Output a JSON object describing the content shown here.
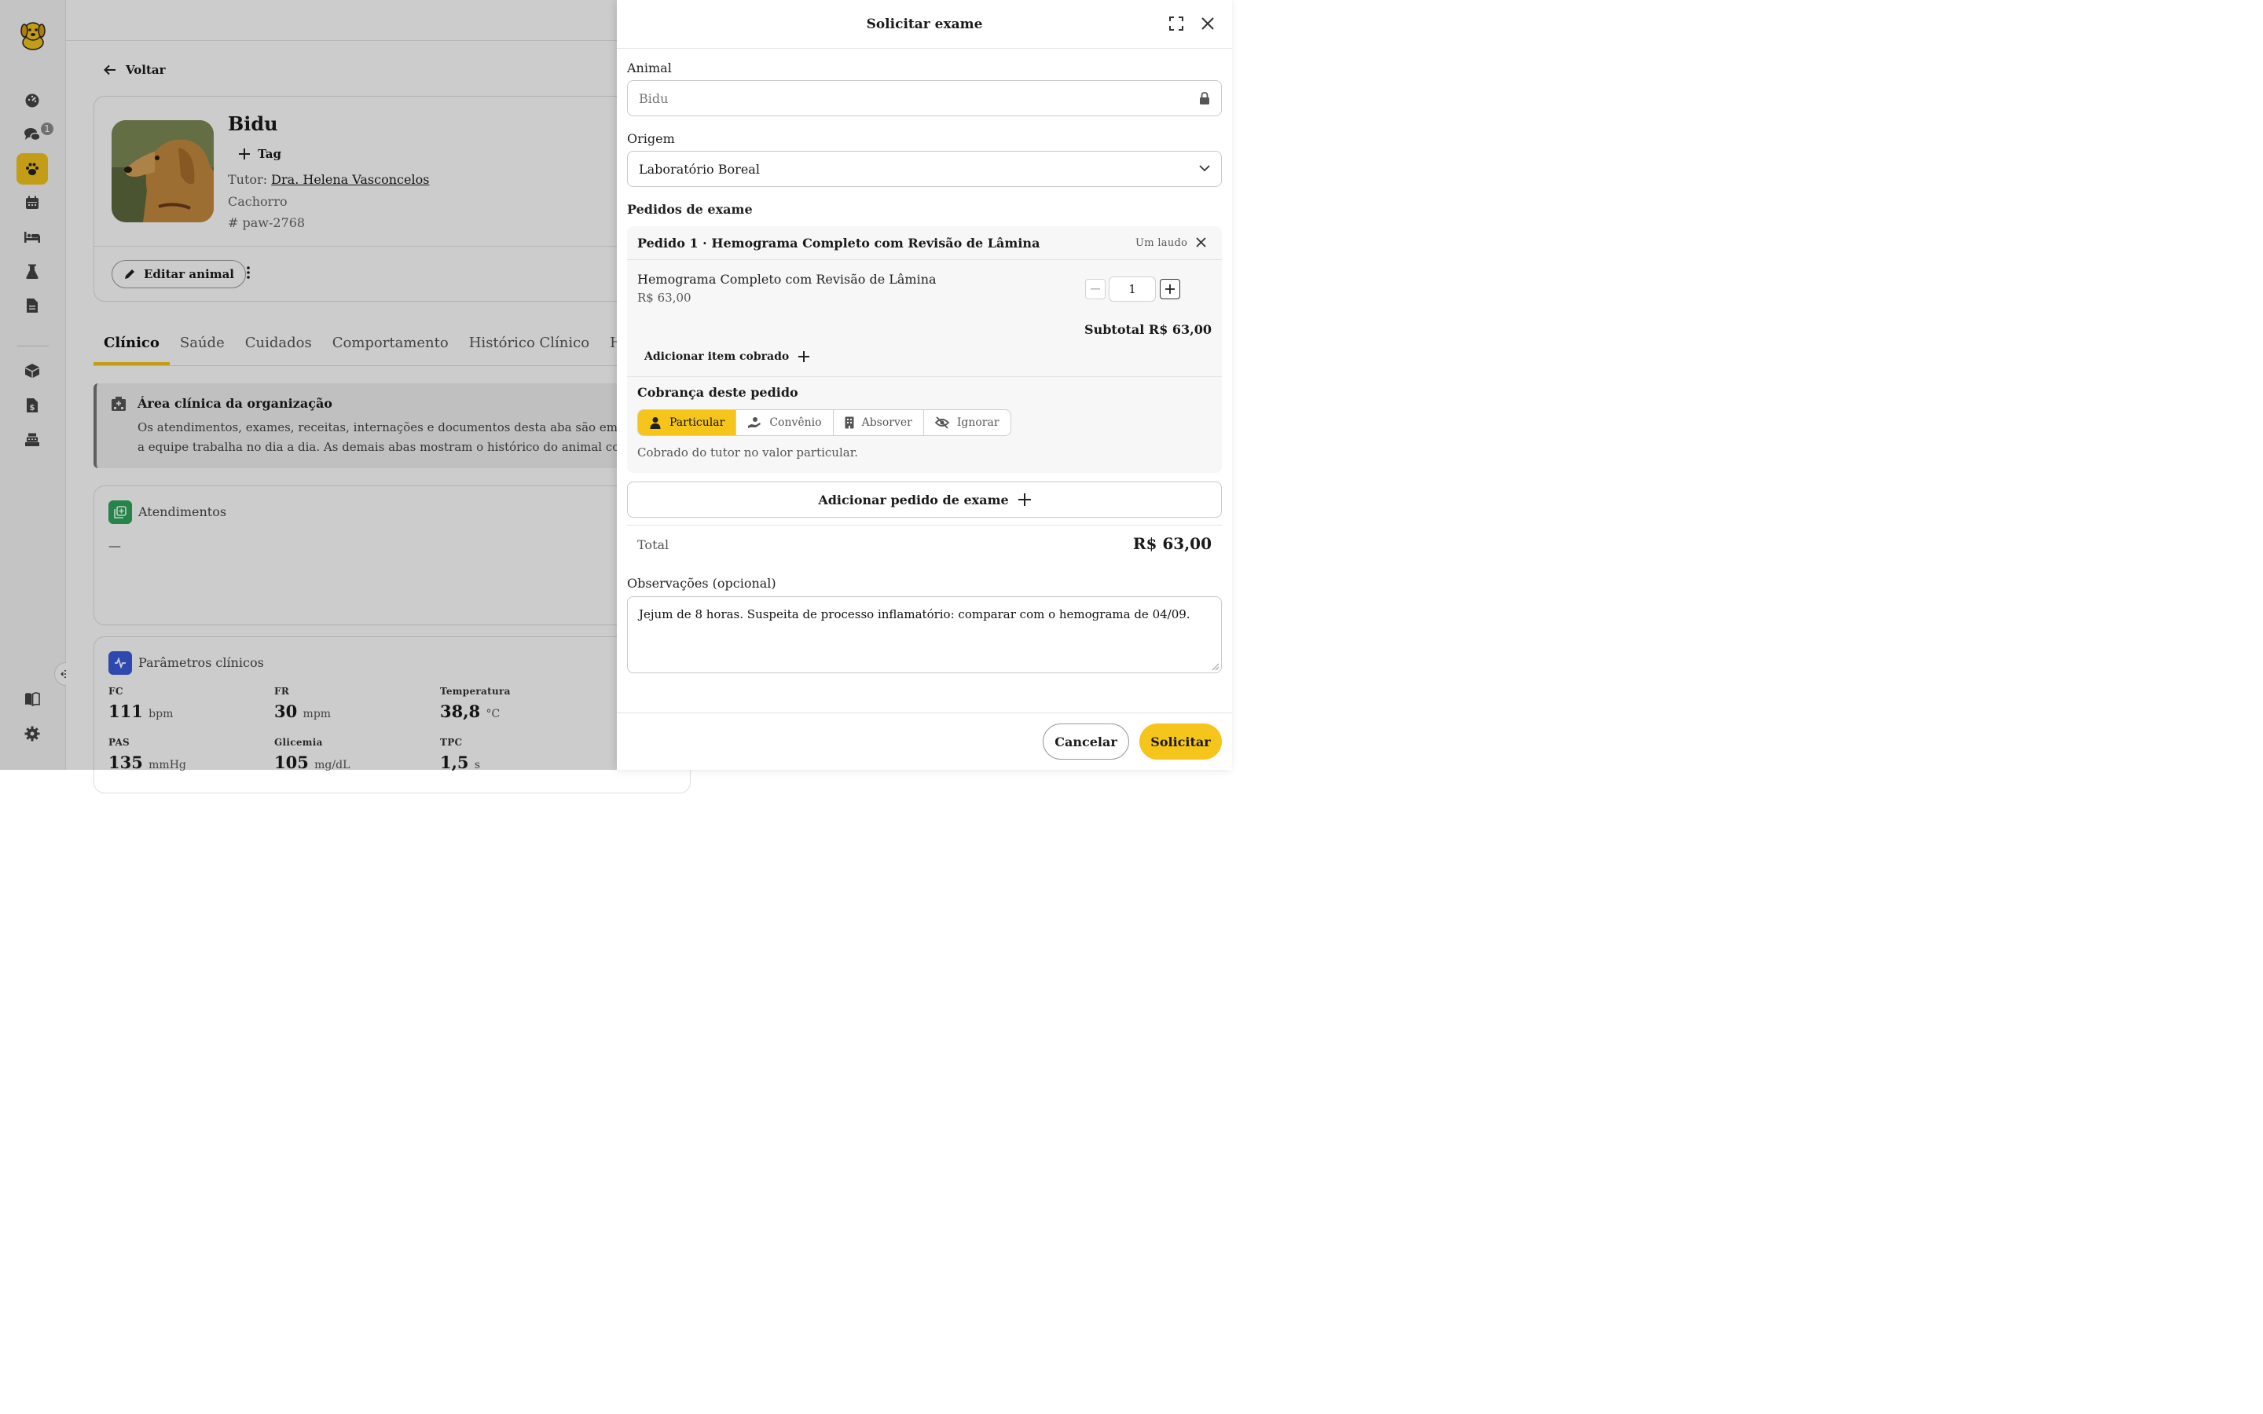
{
  "sidebar": {
    "icons": [
      "logo-icon",
      "dashboard-icon",
      "chat-icon",
      "paw-icon",
      "calendar-icon",
      "bed-icon",
      "flask-icon",
      "document-icon",
      "package-icon",
      "billing-icon",
      "cash-register-icon",
      "book-icon",
      "gear-icon"
    ],
    "chat_badge": "1",
    "active_item": "paw-icon",
    "accent": "#f5c51c"
  },
  "back_label": "Voltar",
  "animal": {
    "name": "Bidu",
    "tag_label": "Tag",
    "tutor_label": "Tutor:",
    "tutor_name": "Dra. Helena Vasconcelos",
    "species": "Cachorro",
    "id": "paw-2768",
    "edit_label": "Editar animal"
  },
  "tabs": [
    {
      "label": "Clínico",
      "active": true
    },
    {
      "label": "Saúde"
    },
    {
      "label": "Cuidados"
    },
    {
      "label": "Comportamento"
    },
    {
      "label": "Histórico Clínico"
    },
    {
      "label": "Hist"
    }
  ],
  "notice": {
    "title": "Área clínica da organização",
    "line1": "Os atendimentos, exames, receitas, internações e documentos desta aba são emitidos pela s",
    "line2": "a equipe trabalha no dia a dia. As demais abas mostram o histórico do animal compartilha"
  },
  "atendimentos": {
    "title": "Atendimentos",
    "empty": "—"
  },
  "parametros": {
    "title": "Parâmetros clínicos",
    "items": [
      {
        "label": "FC",
        "value": "111",
        "unit": "bpm"
      },
      {
        "label": "FR",
        "value": "30",
        "unit": "mpm"
      },
      {
        "label": "Temperatura",
        "value": "38,8",
        "unit": "°C"
      },
      {
        "label": "PAS",
        "value": "135",
        "unit": "mmHg"
      },
      {
        "label": "Glicemia",
        "value": "105",
        "unit": "mg/dL"
      },
      {
        "label": "TPC",
        "value": "1,5",
        "unit": "s"
      }
    ]
  },
  "drawer": {
    "title": "Solicitar exame",
    "animal_label": "Animal",
    "animal_value": "Bidu",
    "origem_label": "Origem",
    "origem_value": "Laboratório Boreal",
    "pedidos_label": "Pedidos de exame",
    "pedido": {
      "title": "Pedido 1 · Hemograma Completo com Revisão de Lâmina",
      "laudo": "Um laudo",
      "item_name": "Hemograma Completo com Revisão de Lâmina",
      "item_price": "R$ 63,00",
      "quantity": "1",
      "subtotal": "Subtotal R$ 63,00",
      "add_item": "Adicionar item cobrado",
      "cobranca_title": "Cobrança deste pedido",
      "cobranca_options": [
        "Particular",
        "Convênio",
        "Absorver",
        "Ignorar"
      ],
      "cobranca_selected": "Particular",
      "cobranca_note": "Cobrado do tutor no valor particular."
    },
    "add_pedido": "Adicionar pedido de exame",
    "total_label": "Total",
    "total_value": "R$ 63,00",
    "obs_label": "Observações (opcional)",
    "obs_value": "Jejum de 8 horas. Suspeita de processo inflamatório: comparar com o hemograma de 04/09.",
    "cancel_label": "Cancelar",
    "submit_label": "Solicitar"
  }
}
